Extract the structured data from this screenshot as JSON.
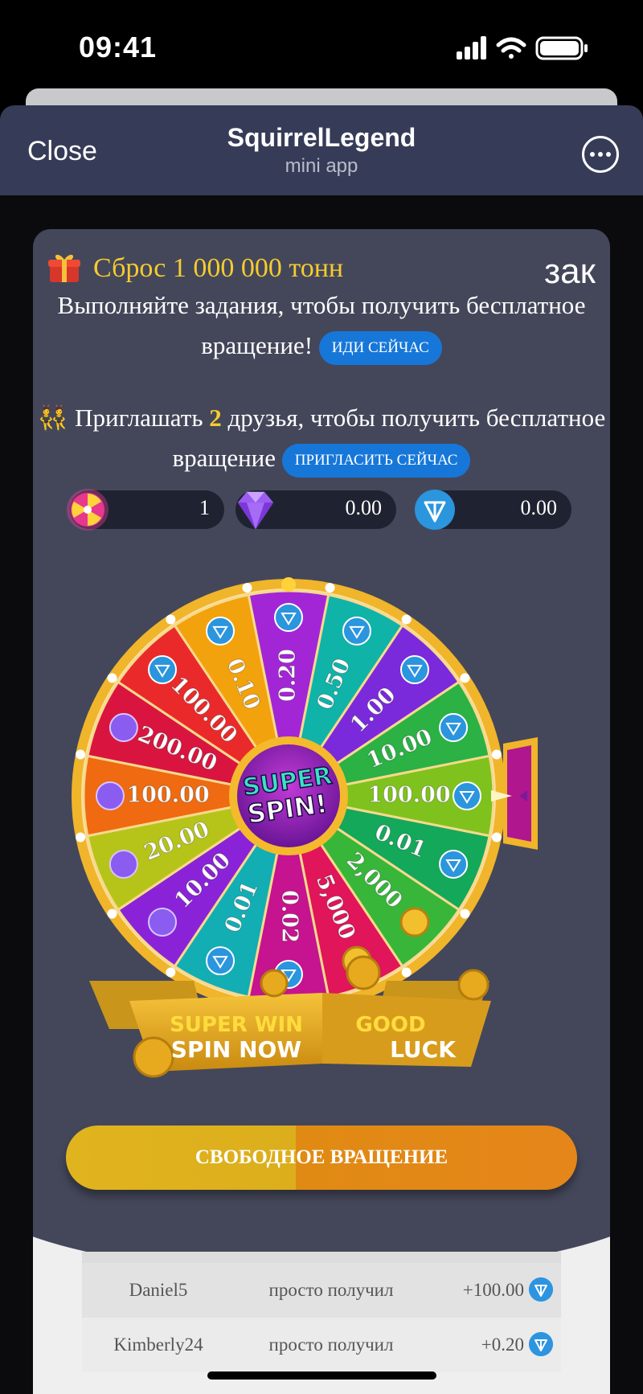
{
  "status_bar": {
    "time": "09:41"
  },
  "header": {
    "close_label": "Close",
    "title": "SquirrelLegend",
    "subtitle": "mini app",
    "menu_icon": "more-icon"
  },
  "announcement": {
    "text": "Сброс 1 000 000 тонн",
    "marquee": "зак"
  },
  "task": {
    "text": "Выполняйте задания, чтобы получить бесплатное вращение!",
    "button": "ИДИ СЕЙЧАС"
  },
  "invite": {
    "text_before": "Приглашать",
    "count": "2",
    "text_after": "друзья, чтобы получить бесплатное вращение",
    "button": "ПРИГЛАСИТЬ СЕЙЧАС"
  },
  "balances": [
    {
      "icon": "spin-wheel-icon",
      "value": "1"
    },
    {
      "icon": "diamond-icon",
      "value": "0.00"
    },
    {
      "icon": "ton-icon",
      "value": "0.00"
    }
  ],
  "wheel": {
    "center_label_1": "SUPER",
    "center_label_2": "SPIN!",
    "segments": [
      {
        "label": "100.00",
        "icon": "ton",
        "color": "#7fc21d"
      },
      {
        "label": "0.01",
        "icon": "ton",
        "color": "#14a85a"
      },
      {
        "label": "2,000",
        "icon": "coin",
        "color": "#37b63a"
      },
      {
        "label": "5,000",
        "icon": "coin",
        "color": "#e0155a"
      },
      {
        "label": "0.02",
        "icon": "ton",
        "color": "#c6138f"
      },
      {
        "label": "0.01",
        "icon": "ton",
        "color": "#12aeb3"
      },
      {
        "label": "10.00",
        "icon": "gem",
        "color": "#8a23d8"
      },
      {
        "label": "20.00",
        "icon": "gem",
        "color": "#b6c41a"
      },
      {
        "label": "100.00",
        "icon": "gem",
        "color": "#ef6a10"
      },
      {
        "label": "200.00",
        "icon": "gem",
        "color": "#d9153f"
      },
      {
        "label": "100.00",
        "icon": "ton",
        "color": "#ea2a2a"
      },
      {
        "label": "0.10",
        "icon": "ton",
        "color": "#f2a20c"
      },
      {
        "label": "0.20",
        "icon": "ton",
        "color": "#a326d6"
      },
      {
        "label": "0.50",
        "icon": "ton",
        "color": "#10b3a8"
      },
      {
        "label": "1.00",
        "icon": "ton",
        "color": "#7a2adb"
      },
      {
        "label": "10.00",
        "icon": "ton",
        "color": "#2bb144"
      }
    ],
    "banner_left_1": "SUPER WIN",
    "banner_left_2": "SPIN NOW",
    "banner_right_1": "GOOD",
    "banner_right_2": "LUCK"
  },
  "free_spin_button": "СВОБОДНОЕ ВРАЩЕНИЕ",
  "winners": [
    {
      "name": "Daniel5",
      "action": "просто получил",
      "amount": "+100.00"
    },
    {
      "name": "Kimberly24",
      "action": "просто получил",
      "amount": "+0.20"
    }
  ]
}
